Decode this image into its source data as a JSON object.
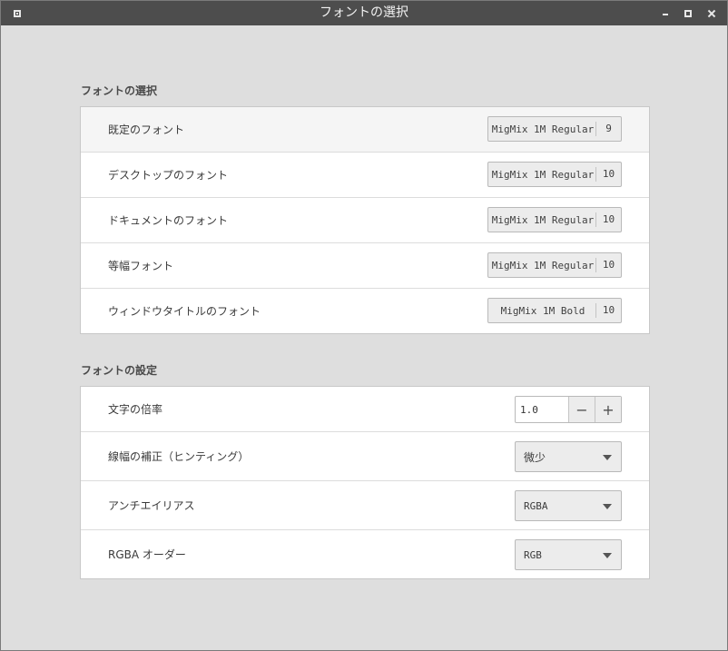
{
  "window": {
    "title": "フォントの選択"
  },
  "font_selection": {
    "heading": "フォントの選択",
    "rows": [
      {
        "label": "既定のフォント",
        "font": "MigMix 1M Regular",
        "size": "9"
      },
      {
        "label": "デスクトップのフォント",
        "font": "MigMix 1M Regular",
        "size": "10"
      },
      {
        "label": "ドキュメントのフォント",
        "font": "MigMix 1M Regular",
        "size": "10"
      },
      {
        "label": "等幅フォント",
        "font": "MigMix 1M Regular",
        "size": "10"
      },
      {
        "label": "ウィンドウタイトルのフォント",
        "font": "MigMix 1M Bold",
        "size": "10"
      }
    ]
  },
  "font_settings": {
    "heading": "フォントの設定",
    "scale": {
      "label": "文字の倍率",
      "value": "1.0",
      "minus": "−",
      "plus": "+"
    },
    "hinting": {
      "label": "線幅の補正（ヒンティング）",
      "value": "微少"
    },
    "antialias": {
      "label": "アンチエイリアス",
      "value": "RGBA"
    },
    "rgba_order": {
      "label": "RGBA オーダー",
      "value": "RGB"
    }
  },
  "icons": {
    "window_menu": "window-menu-icon",
    "minimize": "minimize-icon",
    "maximize": "maximize-icon",
    "close": "close-icon",
    "dropdown": "chevron-down-icon"
  }
}
